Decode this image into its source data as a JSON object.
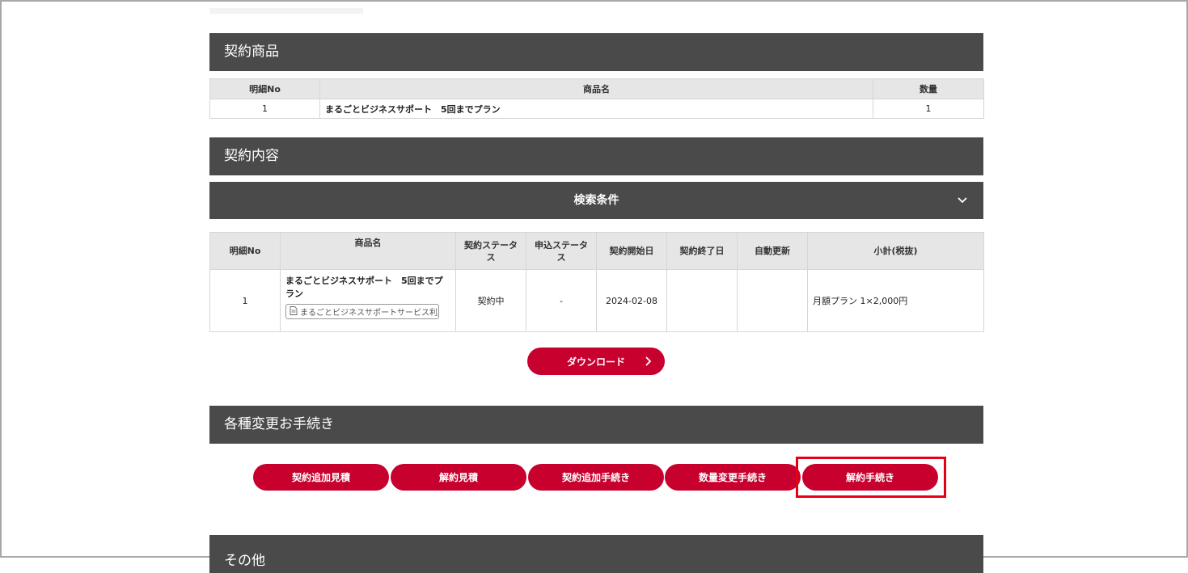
{
  "contract_products": {
    "title": "契約商品",
    "headers": [
      "明細No",
      "商品名",
      "数量"
    ],
    "row": {
      "no": "1",
      "name": "まるごとビジネスサポート　5回までプラン",
      "qty": "1"
    }
  },
  "contract_details": {
    "title": "契約内容",
    "search_title": "検索条件",
    "headers": [
      "明細No",
      "商品名",
      "契約ステータス",
      "申込ステータス",
      "契約開始日",
      "契約終了日",
      "自動更新",
      "小計(税抜)"
    ],
    "row": {
      "no": "1",
      "name": "まるごとビジネスサポート　5回までプラン",
      "doc_link": "まるごとビジネスサポートサービス利用…",
      "contract_status": "契約中",
      "application_status": "-",
      "start_date": "2024-02-08",
      "end_date": "",
      "auto_renew": "",
      "subtotal": "月額プラン 1×2,000円"
    },
    "download_label": "ダウンロード"
  },
  "procedures": {
    "title": "各種変更お手続き",
    "buttons": [
      "契約追加見積",
      "解約見積",
      "契約追加手続き",
      "数量変更手続き",
      "解約手続き"
    ]
  },
  "other": {
    "title": "その他"
  },
  "colors": {
    "accent": "#c8002e",
    "header_bg": "#4a4a4a",
    "highlight": "#e60012"
  },
  "icons": [
    "chevron-down-icon",
    "chevron-right-icon",
    "document-icon"
  ]
}
